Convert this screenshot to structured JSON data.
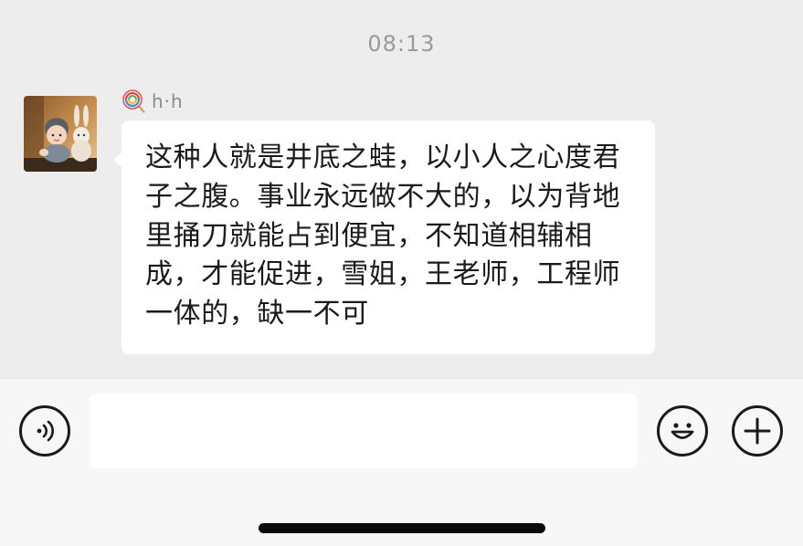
{
  "chat": {
    "timestamp": "08:13",
    "messages": [
      {
        "sender_name": "h·h",
        "avatar": "baby-with-plush-rabbit-photo",
        "badge_icon": "lollipop-icon",
        "text": "这种人就是井底之蛙，以小人之心度君子之腹。事业永远做不大的，以为背地里捅刀就能占到便宜，不知道相辅相成，才能促进，雪姐，王老师，工程师一体的，缺一不可"
      }
    ]
  },
  "input_bar": {
    "text_value": "",
    "voice_icon": "voice-icon",
    "emoji_icon": "emoji-icon",
    "plus_icon": "plus-icon"
  },
  "colors": {
    "background": "#ededed",
    "bubble": "#ffffff",
    "input_bar": "#f7f7f7",
    "timestamp": "#9a9a9a"
  }
}
